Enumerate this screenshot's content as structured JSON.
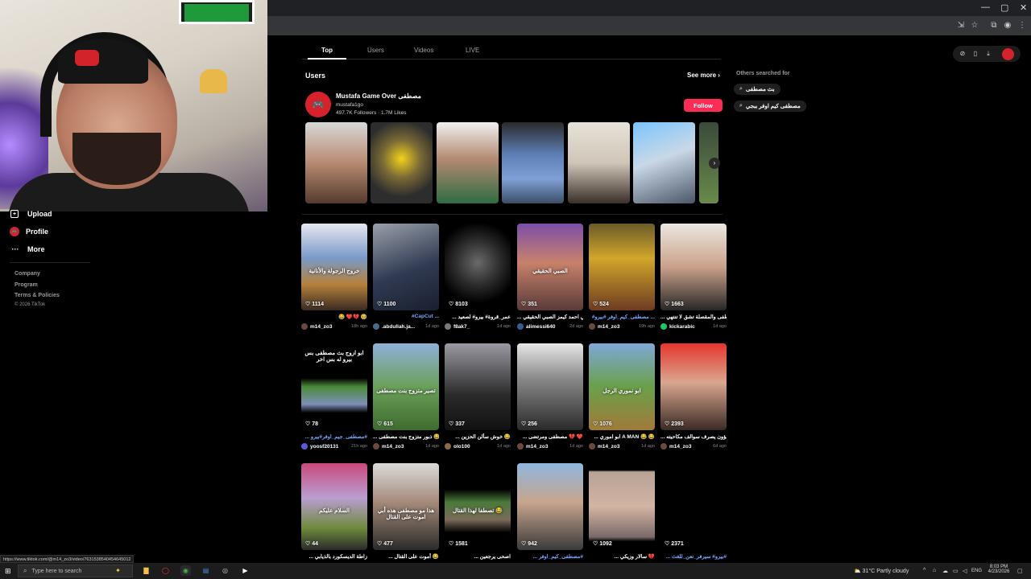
{
  "browser": {
    "window_controls": [
      "—",
      "▢",
      "✕"
    ],
    "toolbar_icons": [
      "install-icon",
      "star-icon",
      "extensions-icon",
      "profile-icon",
      "menu-icon"
    ]
  },
  "sidebar": {
    "items": [
      {
        "label": "Upload",
        "icon": "upload-icon"
      },
      {
        "label": "Profile",
        "icon": "profile-icon"
      },
      {
        "label": "More",
        "icon": "more-icon"
      }
    ],
    "links": [
      "Company",
      "Program",
      "Terms & Policies",
      "© 2026 TikTok"
    ]
  },
  "tabs": [
    "Top",
    "Users",
    "Videos",
    "LIVE"
  ],
  "users_section": {
    "heading": "Users",
    "see_more": "See more",
    "user": {
      "name": "Mustafa Game Over مصطفى",
      "handle": "mustafa1go",
      "followers": "497.7K Followers",
      "likes": "1.7M Likes",
      "follow_label": "Follow"
    }
  },
  "others_searched": {
    "heading": "Others searched for",
    "chips": [
      "بث مصطفى",
      "مصطفى كيم اوفر ببجي"
    ]
  },
  "videos": [
    {
      "likes": "1114",
      "caption": "😂 ❤️💔 🥹",
      "author": "m14_zo3",
      "date": "18h ago",
      "overlay": "خروج الرجولة والأنانية"
    },
    {
      "likes": "1100",
      "caption": "#CapCut ...",
      "author": ".abdullah.ja...",
      "date": "1d ago",
      "tag": true
    },
    {
      "likes": "8103",
      "caption": "... عمر_قروة# بيرو# لصعيد",
      "author": "f8ak7_",
      "date": "1d ago"
    },
    {
      "likes": "351",
      "caption": "... علي احمد كيمز الصبي الحقيقي",
      "author": "alimessi640",
      "date": "2d ago",
      "overlay": "الصبي الحقيقي"
    },
    {
      "likes": "524",
      "caption": "#مصطفى_كيم_اوفر #بيرو ...",
      "author": "m14_zo3",
      "date": "19h ago",
      "tag": true
    },
    {
      "likes": "1663",
      "caption": "... مصطفى والمقصلة تشق لا تنتهي",
      "author": "kickarabic",
      "date": "1d ago"
    },
    {
      "likes": "78",
      "caption": "... مصطفى_جيم_اوفر#بيرو#",
      "author": "yoosf20131",
      "date": "21h ago",
      "tag": true,
      "overlay": "ابو ازوج بث مصطفى بس بيرو له بس اخر"
    },
    {
      "likes": "615",
      "caption": "... ذبور متزوج بنت مصطفى 😂",
      "author": "m14_zo3",
      "date": "1d ago",
      "overlay": "تصير متزوج بنت مصطفى"
    },
    {
      "likes": "337",
      "caption": "... خوش سألن الحزين 😂",
      "author": "olo100",
      "date": "1d ago"
    },
    {
      "likes": "256",
      "caption": "... مصطفى ومرتضى 💔 ❤️",
      "author": "m14_zo3",
      "date": "1d ago"
    },
    {
      "likes": "1076",
      "caption": "... ابو اموري A MAN 😂 😂",
      "author": "m14_zo3",
      "date": "1d ago",
      "overlay": "ابو نموري الرجل"
    },
    {
      "likes": "2393",
      "caption": "... في شؤون يصرف سوالف مكاحيته",
      "author": "m14_zo3",
      "date": "6d ago"
    },
    {
      "likes": "44",
      "caption": "... زاطة الديسكورد بالذيابي",
      "author": "",
      "date": "",
      "overlay": "السلام عليكم"
    },
    {
      "likes": "477",
      "caption": "... أموت على القتال 😂",
      "author": "",
      "date": "",
      "overlay": "هذا مو مصطفى هذه أبي اموت على القتال"
    },
    {
      "likes": "1581",
      "caption": "... اصحى يرجعين",
      "author": "",
      "date": "",
      "overlay": "تصطفا لهذا القتال 😂"
    },
    {
      "likes": "942",
      "caption": "... مصطفى_كيم_اوفر#",
      "author": "",
      "date": "",
      "tag": true
    },
    {
      "likes": "1092",
      "caption": "... سالار وزيكي 💔",
      "author": "",
      "date": "",
      "overlay": ""
    },
    {
      "likes": "2371",
      "caption": "... بيرو# سيرفر_نعن_للغث#",
      "author": "",
      "date": "",
      "tag": true
    }
  ],
  "status_url": "https://www.tiktok.com/@m14_zo3/video/7631538540454645012",
  "taskbar": {
    "search_placeholder": "Type here to search",
    "weather": "31°C  Partly cloudy",
    "lang": "ENG",
    "time": "8:03 PM",
    "date": "4/23/2026"
  }
}
